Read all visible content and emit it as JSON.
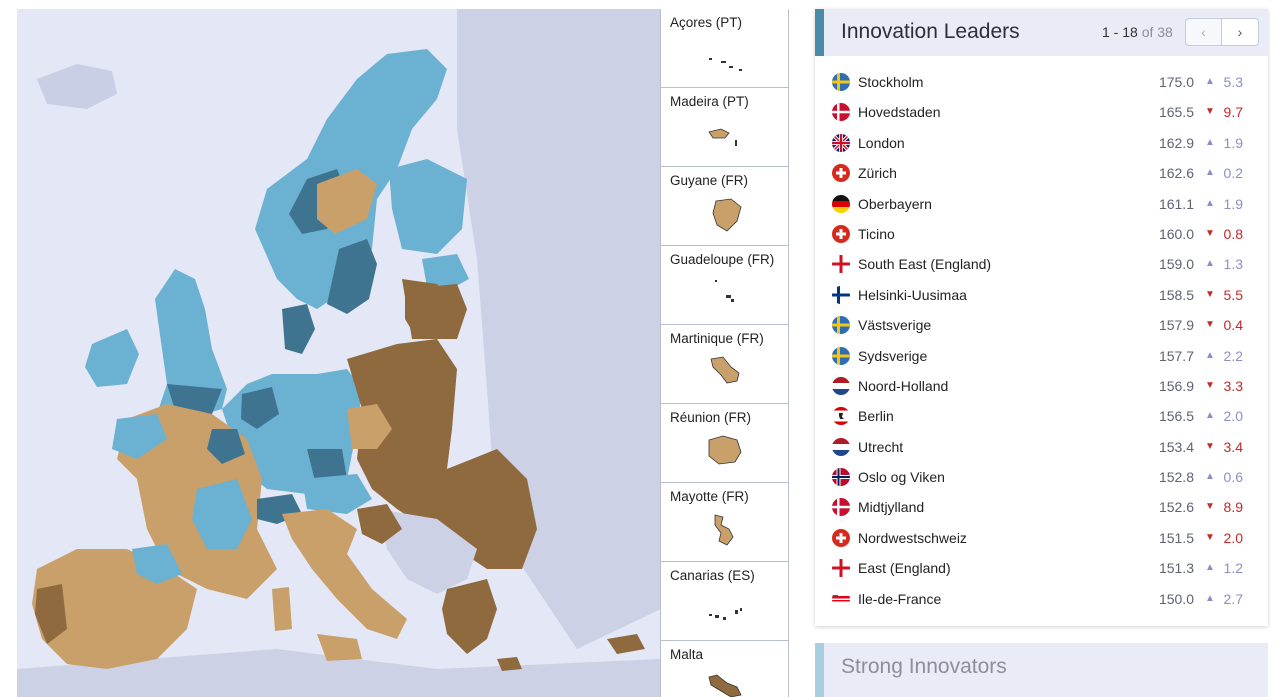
{
  "colors": {
    "leader_dark": "#3f7490",
    "strong": "#6ab1d2",
    "moderate": "#c9a06a",
    "emerging": "#8e6a3e",
    "land_outside": "#ccd1e6",
    "sea": "#e4e7f5",
    "up": "#8a8fc7",
    "down": "#c62828"
  },
  "insets": [
    {
      "label": "Açores (PT)",
      "icon": "azores-islands-icon"
    },
    {
      "label": "Madeira (PT)",
      "icon": "madeira-island-icon"
    },
    {
      "label": "Guyane (FR)",
      "icon": "guyane-region-icon"
    },
    {
      "label": "Guadeloupe (FR)",
      "icon": "guadeloupe-island-icon"
    },
    {
      "label": "Martinique (FR)",
      "icon": "martinique-island-icon"
    },
    {
      "label": "Réunion (FR)",
      "icon": "reunion-island-icon"
    },
    {
      "label": "Mayotte (FR)",
      "icon": "mayotte-island-icon"
    },
    {
      "label": "Canarias (ES)",
      "icon": "canarias-islands-icon"
    },
    {
      "label": "Malta",
      "icon": "malta-island-icon"
    }
  ],
  "panel": {
    "title": "Innovation Leaders",
    "pager_range": "1 - 18",
    "pager_of": "of 38",
    "prev_icon": "‹",
    "next_icon": "›"
  },
  "regions": [
    {
      "name": "Stockholm",
      "flag": "se",
      "score": "175.0",
      "dir": "up",
      "delta": "5.3"
    },
    {
      "name": "Hovedstaden",
      "flag": "dk",
      "score": "165.5",
      "dir": "down",
      "delta": "9.7"
    },
    {
      "name": "London",
      "flag": "uk",
      "score": "162.9",
      "dir": "up",
      "delta": "1.9"
    },
    {
      "name": "Zürich",
      "flag": "ch",
      "score": "162.6",
      "dir": "up",
      "delta": "0.2"
    },
    {
      "name": "Oberbayern",
      "flag": "de",
      "score": "161.1",
      "dir": "up",
      "delta": "1.9"
    },
    {
      "name": "Ticino",
      "flag": "ch",
      "score": "160.0",
      "dir": "down",
      "delta": "0.8"
    },
    {
      "name": "South East (England)",
      "flag": "en",
      "score": "159.0",
      "dir": "up",
      "delta": "1.3"
    },
    {
      "name": "Helsinki-Uusimaa",
      "flag": "fi",
      "score": "158.5",
      "dir": "down",
      "delta": "5.5"
    },
    {
      "name": "Västsverige",
      "flag": "se",
      "score": "157.9",
      "dir": "down",
      "delta": "0.4"
    },
    {
      "name": "Sydsverige",
      "flag": "se",
      "score": "157.7",
      "dir": "up",
      "delta": "2.2"
    },
    {
      "name": "Noord-Holland",
      "flag": "nl",
      "score": "156.9",
      "dir": "down",
      "delta": "3.3"
    },
    {
      "name": "Berlin",
      "flag": "berlin",
      "score": "156.5",
      "dir": "up",
      "delta": "2.0"
    },
    {
      "name": "Utrecht",
      "flag": "nl",
      "score": "153.4",
      "dir": "down",
      "delta": "3.4"
    },
    {
      "name": "Oslo og Viken",
      "flag": "no",
      "score": "152.8",
      "dir": "up",
      "delta": "0.6"
    },
    {
      "name": "Midtjylland",
      "flag": "dk",
      "score": "152.6",
      "dir": "down",
      "delta": "8.9"
    },
    {
      "name": "Nordwestschweiz",
      "flag": "ch",
      "score": "151.5",
      "dir": "down",
      "delta": "2.0"
    },
    {
      "name": "East (England)",
      "flag": "en",
      "score": "151.3",
      "dir": "up",
      "delta": "1.2"
    },
    {
      "name": "Ile-de-France",
      "flag": "idf",
      "score": "150.0",
      "dir": "up",
      "delta": "2.7"
    }
  ],
  "next_section": {
    "title": "Strong Innovators"
  }
}
